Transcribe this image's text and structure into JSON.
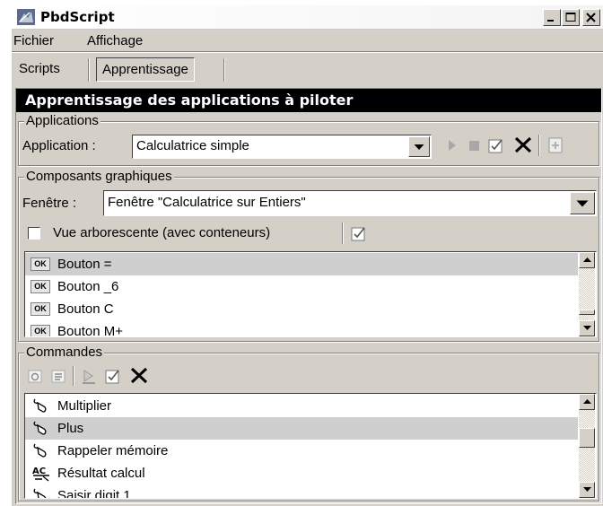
{
  "window": {
    "title": "PbdScript",
    "controls": [
      "minimize-icon",
      "maximize-icon",
      "close-icon"
    ]
  },
  "menu": [
    "Fichier",
    "Affichage"
  ],
  "tabs": [
    {
      "label": "Scripts",
      "active": false
    },
    {
      "label": "Apprentissage",
      "active": true
    }
  ],
  "panel": {
    "title": "Apprentissage des applications à piloter"
  },
  "applications": {
    "legend": "Applications",
    "label": "Application :",
    "selected": "Calculatrice simple",
    "toolbar_icons": [
      "play-icon",
      "stop-icon",
      "validate-icon",
      "delete-icon",
      "add-icon"
    ]
  },
  "composants": {
    "legend": "Composants graphiques",
    "window_label": "Fenêtre :",
    "window_selected": "Fenêtre \"Calculatrice sur Entiers\"",
    "tree_view_label": "Vue arborescente (avec conteneurs)",
    "tree_view_checked": false,
    "items": [
      {
        "icon": "OK",
        "label": "Bouton =",
        "selected": true
      },
      {
        "icon": "OK",
        "label": "Bouton _6",
        "selected": false
      },
      {
        "icon": "OK",
        "label": "Bouton C",
        "selected": false
      },
      {
        "icon": "OK",
        "label": "Bouton M+",
        "selected": false
      }
    ]
  },
  "commandes": {
    "legend": "Commandes",
    "toolbar_icons": [
      "record-icon",
      "properties-icon",
      "run-icon",
      "validate-icon",
      "delete-icon"
    ],
    "items": [
      {
        "icon": "mouse-icon",
        "label": "Multiplier",
        "selected": false
      },
      {
        "icon": "mouse-icon",
        "label": "Plus",
        "selected": true
      },
      {
        "icon": "mouse-icon",
        "label": "Rappeler mémoire",
        "selected": false
      },
      {
        "icon": "text-field-icon",
        "label": "Résultat calcul",
        "selected": false
      },
      {
        "icon": "mouse-icon",
        "label": "Saisir digit 1",
        "selected": false
      }
    ]
  },
  "colors": {
    "panel_header_bg": "#000000",
    "selection": "#cfcfcf",
    "face": "#d4d0c8"
  }
}
